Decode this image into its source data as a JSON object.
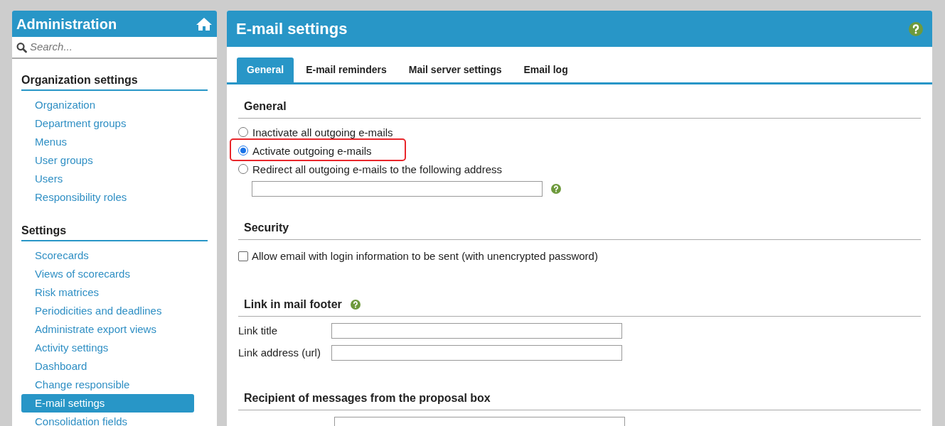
{
  "sidebar": {
    "title": "Administration",
    "search": {
      "placeholder": "Search..."
    },
    "sections": [
      {
        "title": "Organization settings",
        "items": [
          {
            "label": "Organization",
            "selected": false
          },
          {
            "label": "Department groups",
            "selected": false
          },
          {
            "label": "Menus",
            "selected": false
          },
          {
            "label": "User groups",
            "selected": false
          },
          {
            "label": "Users",
            "selected": false
          },
          {
            "label": "Responsibility roles",
            "selected": false
          }
        ]
      },
      {
        "title": "Settings",
        "items": [
          {
            "label": "Scorecards",
            "selected": false
          },
          {
            "label": "Views of scorecards",
            "selected": false
          },
          {
            "label": "Risk matrices",
            "selected": false
          },
          {
            "label": "Periodicities and deadlines",
            "selected": false
          },
          {
            "label": "Administrate export views",
            "selected": false
          },
          {
            "label": "Activity settings",
            "selected": false
          },
          {
            "label": "Dashboard",
            "selected": false
          },
          {
            "label": "Change responsible",
            "selected": false
          },
          {
            "label": "E-mail settings",
            "selected": true
          },
          {
            "label": "Consolidation fields",
            "selected": false
          }
        ]
      }
    ]
  },
  "main": {
    "title": "E-mail settings",
    "tabs": [
      {
        "label": "General",
        "selected": true
      },
      {
        "label": "E-mail reminders",
        "selected": false
      },
      {
        "label": "Mail server settings",
        "selected": false
      },
      {
        "label": "Email log",
        "selected": false
      }
    ],
    "general": {
      "title": "General",
      "options": [
        {
          "label": "Inactivate all outgoing e-mails",
          "selected": false
        },
        {
          "label": "Activate outgoing e-mails",
          "selected": true
        },
        {
          "label": "Redirect all outgoing e-mails to the following address",
          "selected": false
        }
      ]
    },
    "security": {
      "title": "Security",
      "checkbox": {
        "label": "Allow email with login information to be sent (with unencrypted password)",
        "checked": false
      }
    },
    "footer_link": {
      "title": "Link in mail footer",
      "fields": [
        {
          "label": "Link title"
        },
        {
          "label": "Link address (url)"
        }
      ]
    },
    "proposal": {
      "title": "Recipient of messages from the proposal box"
    }
  }
}
